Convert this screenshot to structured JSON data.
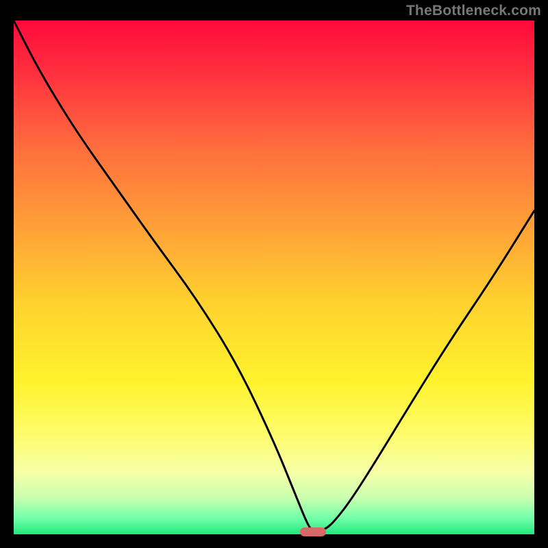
{
  "watermark": "TheBottleneck.com",
  "chart_data": {
    "type": "line",
    "title": "",
    "xlabel": "",
    "ylabel": "",
    "xlim": [
      0,
      100
    ],
    "ylim": [
      0,
      100
    ],
    "grid": false,
    "series": [
      {
        "name": "curve",
        "x": [
          0,
          4,
          8,
          13,
          20,
          27,
          35,
          43,
          50,
          54,
          56,
          57,
          58,
          60,
          62,
          65,
          70,
          76,
          84,
          92,
          100
        ],
        "y": [
          100,
          92,
          85,
          77,
          67,
          57,
          46,
          33,
          18,
          8,
          3,
          1,
          0.5,
          1,
          3,
          7,
          15,
          25,
          38,
          50,
          63
        ]
      }
    ],
    "marker": {
      "x_center": 57.5,
      "width_pct": 5.0,
      "y_value": 0
    },
    "legend": {
      "visible": false
    }
  },
  "vibe": {
    "gradient_stops": [
      {
        "offset": 0,
        "color": "#ff0a3a"
      },
      {
        "offset": 0.1,
        "color": "#ff2f3f"
      },
      {
        "offset": 0.25,
        "color": "#ff6e3d"
      },
      {
        "offset": 0.4,
        "color": "#ffa038"
      },
      {
        "offset": 0.55,
        "color": "#ffd22e"
      },
      {
        "offset": 0.7,
        "color": "#fff22c"
      },
      {
        "offset": 0.8,
        "color": "#fffc68"
      },
      {
        "offset": 0.88,
        "color": "#f6ffa8"
      },
      {
        "offset": 0.93,
        "color": "#c8ffb0"
      },
      {
        "offset": 0.97,
        "color": "#6fffa8"
      },
      {
        "offset": 1.0,
        "color": "#23e77a"
      }
    ],
    "curve_stroke": "#000000",
    "curve_width": 3.0,
    "marker_color": "#d96868"
  }
}
